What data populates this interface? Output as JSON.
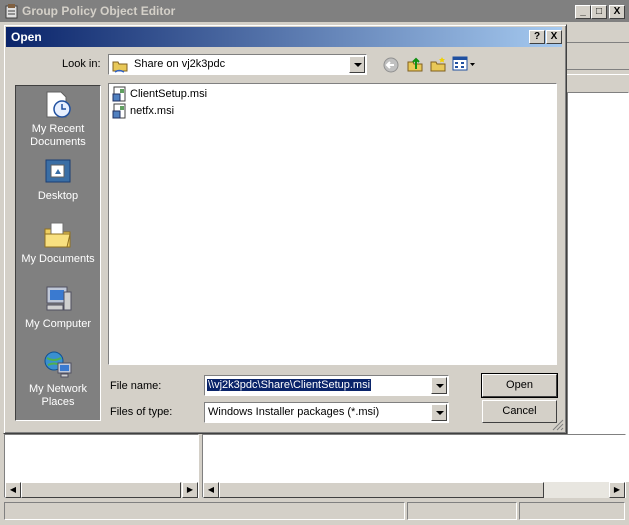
{
  "background_window": {
    "title": "Group Policy Object Editor",
    "caption_buttons": [
      "_",
      "□",
      "X"
    ]
  },
  "dialog": {
    "title": "Open",
    "help_label": "?",
    "close_label": "X",
    "look_in_label": "Look in:",
    "look_in_value": "Share on vj2k3pdc",
    "places": [
      {
        "label": "My Recent Documents",
        "icon": "recent-documents-icon"
      },
      {
        "label": "Desktop",
        "icon": "desktop-icon"
      },
      {
        "label": "My Documents",
        "icon": "my-documents-icon"
      },
      {
        "label": "My Computer",
        "icon": "my-computer-icon"
      },
      {
        "label": "My Network Places",
        "icon": "network-places-icon"
      }
    ],
    "files": [
      "ClientSetup.msi",
      "netfx.msi"
    ],
    "file_name_label": "File name:",
    "file_name_value": "\\\\vj2k3pdc\\Share\\ClientSetup.msi",
    "files_of_type_label": "Files of type:",
    "files_of_type_value": "Windows Installer packages (*.msi)",
    "open_button": "Open",
    "cancel_button": "Cancel"
  }
}
